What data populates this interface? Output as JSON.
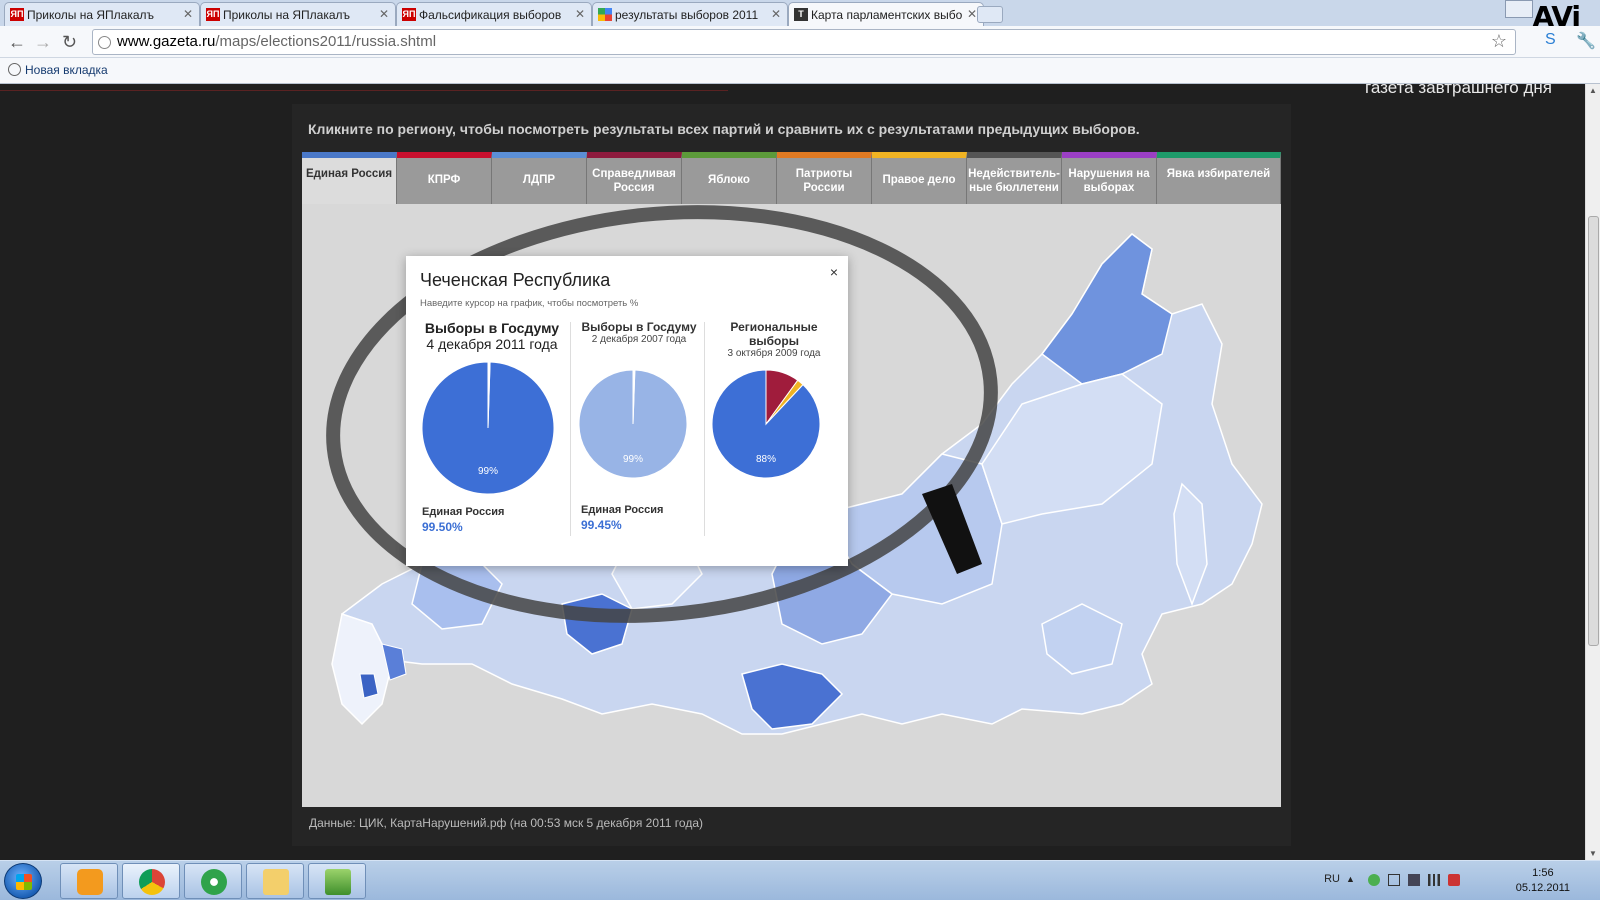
{
  "tabs": [
    {
      "label": "Приколы на ЯПлакалъ",
      "icon": "ЯП"
    },
    {
      "label": "Приколы на ЯПлакалъ",
      "icon": "ЯП"
    },
    {
      "label": "Фальсификация выборов",
      "icon": "ЯП"
    },
    {
      "label": "результаты выборов 2011",
      "icon": "google-icon"
    },
    {
      "label": "Карта парламентских выбо",
      "icon": "T"
    }
  ],
  "address": {
    "host": "www.gazeta.ru",
    "path": "/maps/elections2011/russia.shtml"
  },
  "bookmarks": [
    {
      "label": "Новая вкладка"
    }
  ],
  "overlay_logo": "AVi",
  "page": {
    "slogan": "газета завтрашнего дня",
    "instruction": "Кликните по региону, чтобы посмотреть результаты всех партий и сравнить их с результатами предыдущих выборов.",
    "party_tabs": [
      {
        "label": "Единая Россия",
        "color": "#4a78c8",
        "active": true
      },
      {
        "label": "КПРФ",
        "color": "#c8102e",
        "active": false
      },
      {
        "label": "ЛДПР",
        "color": "#5b8fd6",
        "active": false
      },
      {
        "label": "Справедливая Россия",
        "color": "#8e1b3e",
        "active": false
      },
      {
        "label": "Яблоко",
        "color": "#5c9a3a",
        "active": false
      },
      {
        "label": "Патриоты России",
        "color": "#e07a23",
        "active": false
      },
      {
        "label": "Правое дело",
        "color": "#f0b323",
        "active": false
      },
      {
        "label": "Недействитель-ные бюллетени",
        "color": "#555555",
        "active": false
      },
      {
        "label": "Нарушения на выборах",
        "color": "#9b3fc4",
        "active": false
      },
      {
        "label": "Явка избирателей",
        "color": "#1e9a6a",
        "active": false
      }
    ],
    "data_source": "Данные: ЦИК, КартаНарушений.рф (на 00:53 мск 5 декабря 2011 года)"
  },
  "popup": {
    "region": "Чеченская Республика",
    "hint": "Наведите курсор на график, чтобы посмотреть %",
    "close": "×",
    "columns": [
      {
        "title": "Выборы в Госдуму",
        "date": "4 декабря 2011 года",
        "pie_label": "99%",
        "party": "Единая Россия",
        "value": "99.50%",
        "share": 0.995,
        "color": "#3d6fd6"
      },
      {
        "title": "Выборы в Госдуму",
        "date": "2 декабря 2007 года",
        "pie_label": "99%",
        "party": "Единая Россия",
        "value": "99.45%",
        "share": 0.9945,
        "color": "#98b4e6"
      },
      {
        "title": "Региональные выборы",
        "date": "3 октября 2009 года",
        "pie_label": "88%",
        "party": "",
        "value": "",
        "share": 0.88,
        "color": "#3d6fd6"
      }
    ],
    "third_pie_other": [
      {
        "share": 0.1,
        "color": "#a01c3c"
      },
      {
        "share": 0.02,
        "color": "#f0b323"
      }
    ]
  },
  "taskbar": {
    "lang": "RU",
    "time": "1:56",
    "date": "05.12.2011"
  },
  "colors": {
    "map_background": "#d8d8d8",
    "region_light": "#c9d6f0",
    "region_mid": "#8fa9e4",
    "region_dark": "#4a72d2"
  }
}
